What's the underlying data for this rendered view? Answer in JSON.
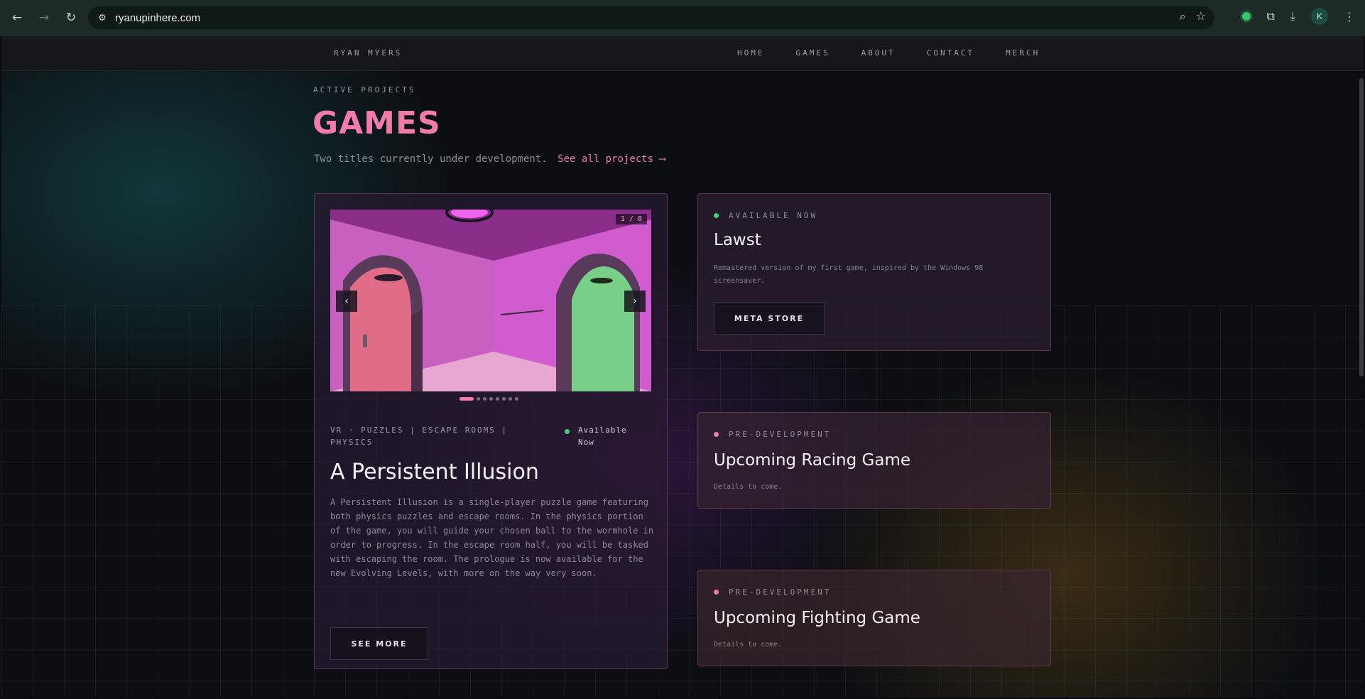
{
  "browser": {
    "url": "ryanupinhere.com",
    "avatar_letter": "K"
  },
  "site": {
    "brand": "RYAN MYERS",
    "nav": [
      "HOME",
      "GAMES",
      "ABOUT",
      "CONTACT",
      "MERCH"
    ]
  },
  "header": {
    "eyebrow": "ACTIVE PROJECTS",
    "title": "GAMES",
    "subtitle": "Two titles currently under development.",
    "link": "See all projects ⟶"
  },
  "featured": {
    "counter": "1 / 8",
    "slides_total": 8,
    "active_slide": 1,
    "tags": "VR · PUZZLES | ESCAPE ROOMS | PHYSICS",
    "status": "Available Now",
    "status_color": "#40d080",
    "title": "A Persistent Illusion",
    "description": "A Persistent Illusion is a single-player puzzle game featuring both physics puzzles and escape rooms. In the physics portion of the game, you will guide your chosen ball to the wormhole in order to progress. In the escape room half, you will be tasked with escaping the room. The prologue is now available for the new Evolving Levels, with more on the way very soon.",
    "button": "SEE MORE"
  },
  "cards": [
    {
      "status": "AVAILABLE NOW",
      "status_color": "#40d080",
      "title": "Lawst",
      "description": "Remastered version of my first game, inspired by the Windows 98 screensaver.",
      "button": "META STORE"
    },
    {
      "status": "PRE-DEVELOPMENT",
      "status_color": "#f07cac",
      "title": "Upcoming Racing Game",
      "description": "Details to come."
    },
    {
      "status": "PRE-DEVELOPMENT",
      "status_color": "#f07cac",
      "title": "Upcoming Fighting Game",
      "description": "Details to come."
    }
  ],
  "colors": {
    "accent": "#f07cac",
    "available": "#40d080"
  }
}
